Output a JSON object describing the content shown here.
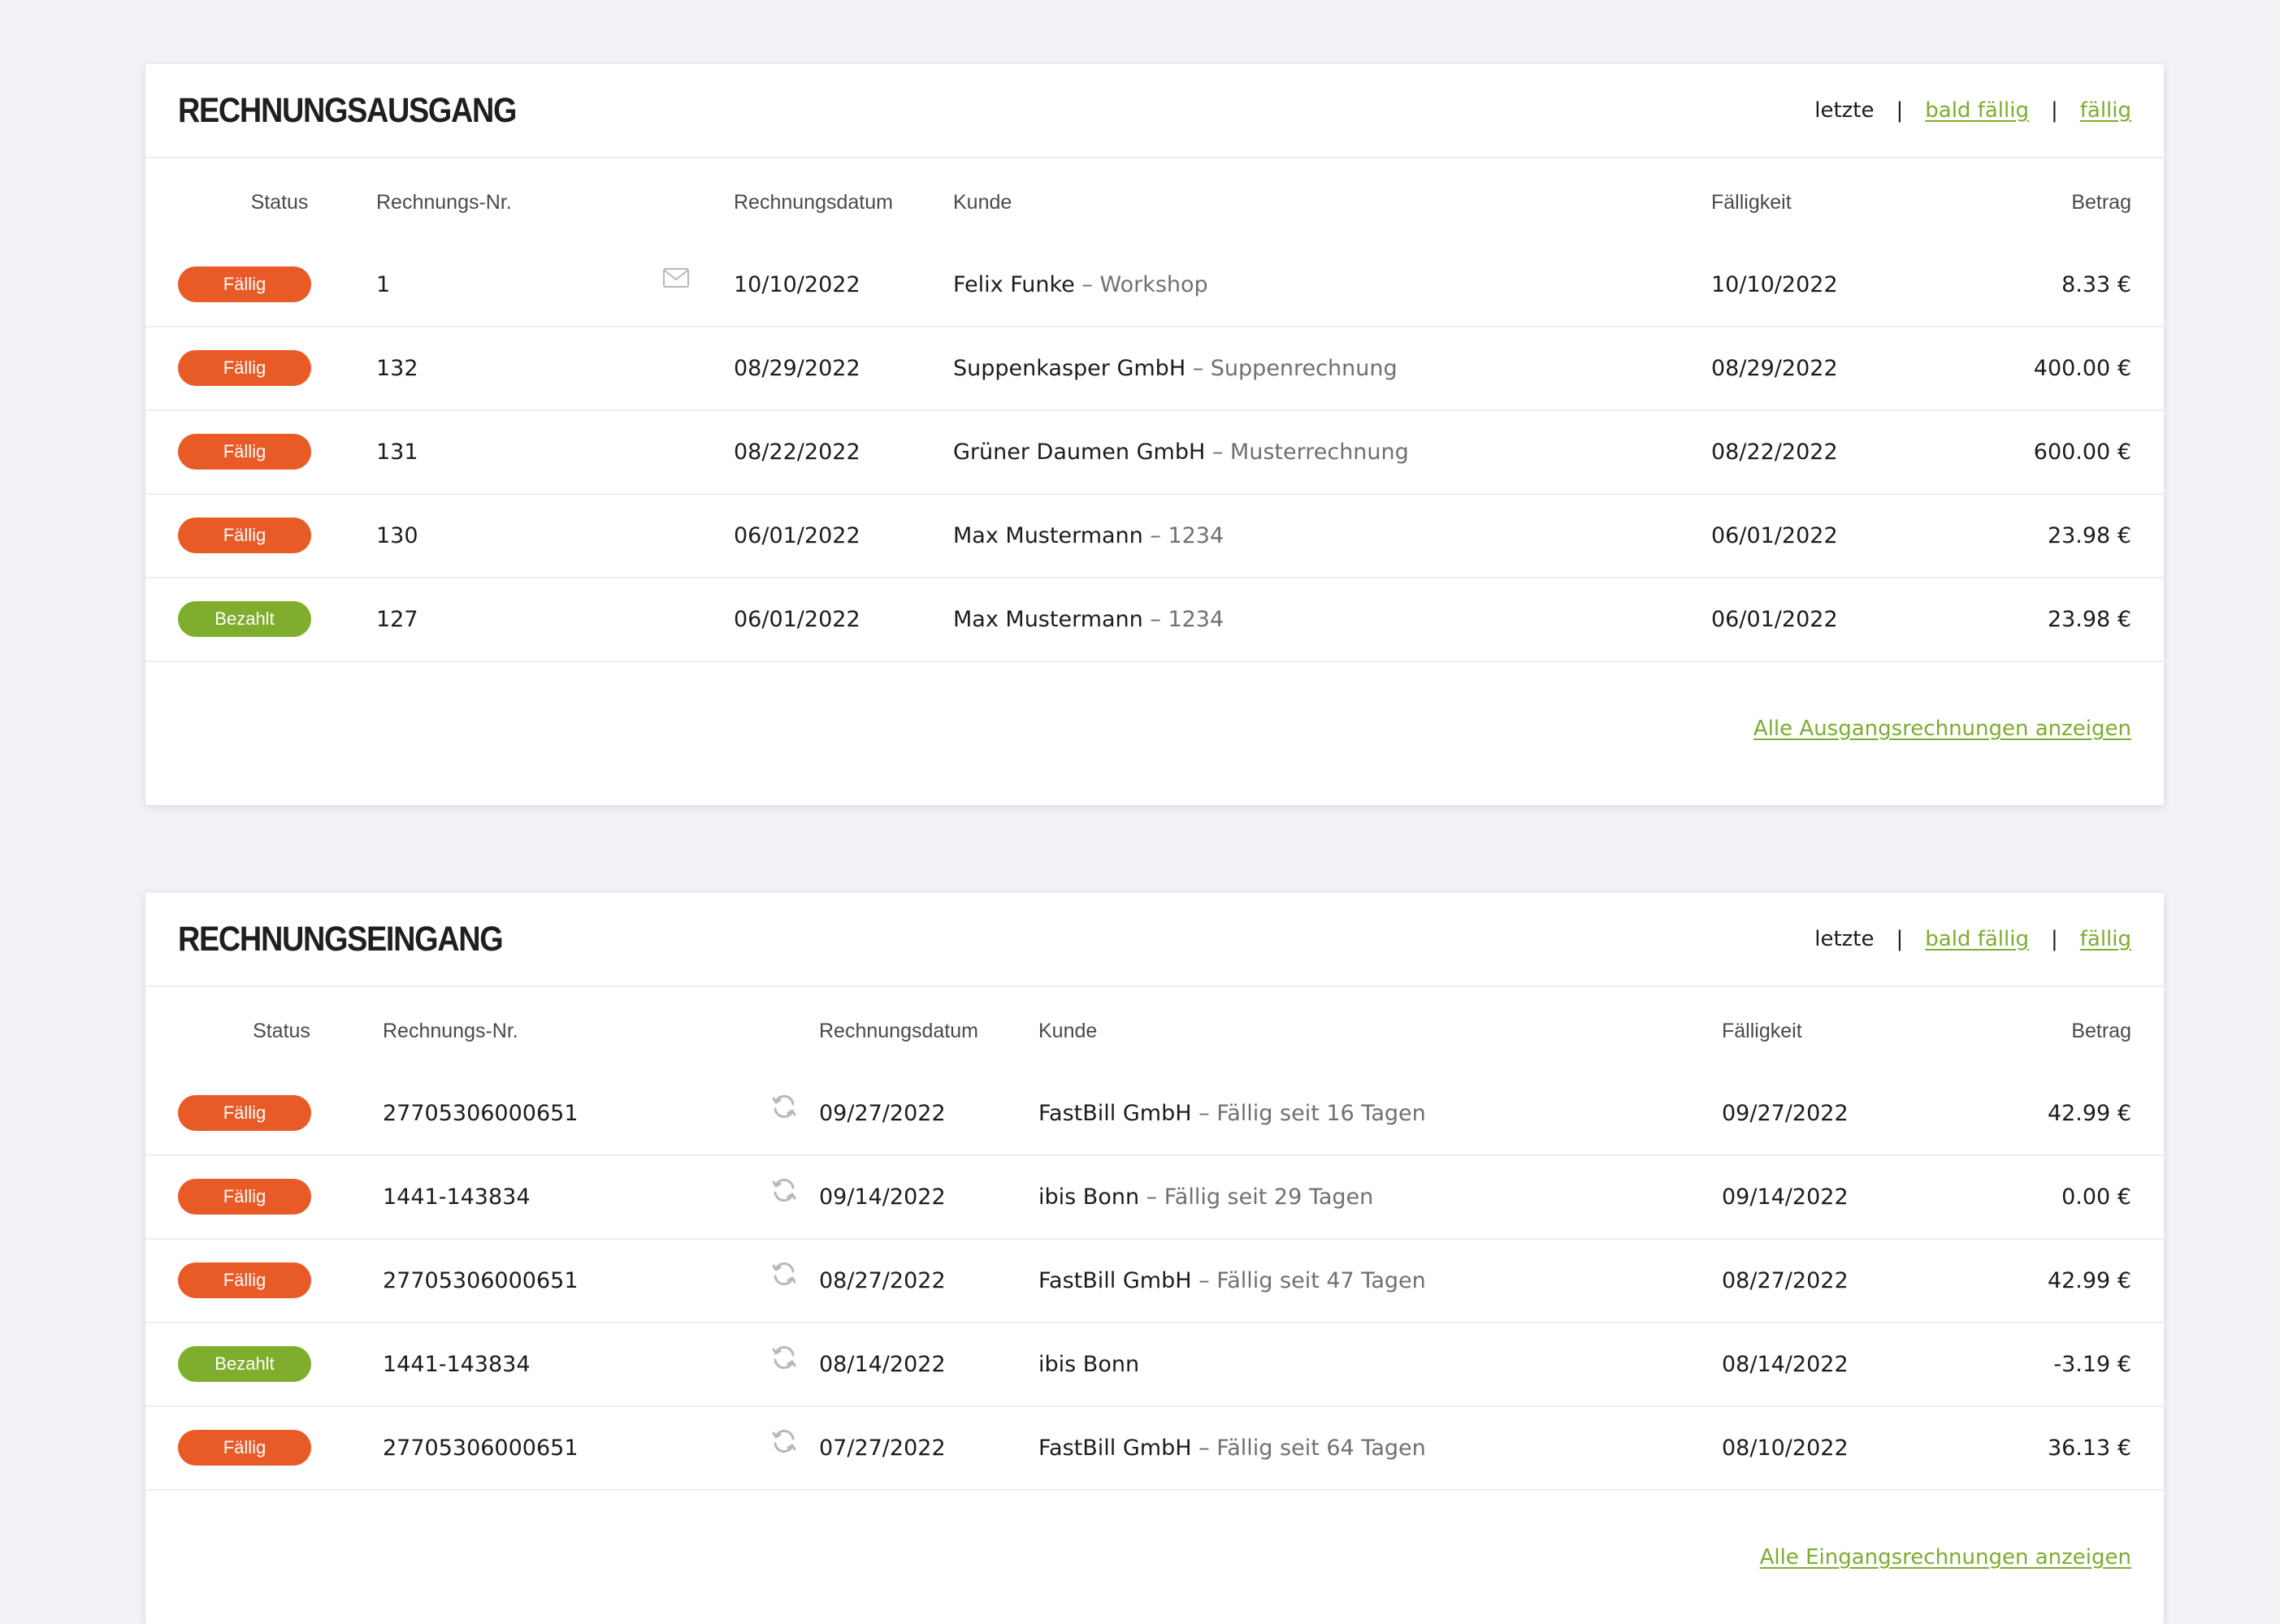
{
  "outgoing": {
    "title": "RECHNUNGSAUSGANG",
    "filters": {
      "active": "letzte",
      "sep": "|",
      "soon": "bald fällig ",
      "due": "fällig"
    },
    "columns": {
      "status": "Status",
      "number": "Rechnungs-Nr.",
      "date": "Rechnungsdatum",
      "customer": "Kunde",
      "due": "Fälligkeit",
      "amount": "Betrag"
    },
    "rows": [
      {
        "status": "Fällig",
        "status_kind": "due",
        "number": "1",
        "icon": "envelope-icon",
        "date": "10/10/2022",
        "customer": "Felix Funke",
        "subject": " – Workshop",
        "due": "10/10/2022",
        "amount": "8.33 €"
      },
      {
        "status": "Fällig",
        "status_kind": "due",
        "number": "132",
        "date": "08/29/2022",
        "customer": "Suppenkasper GmbH",
        "subject": " – Suppenrechnung",
        "due": "08/29/2022",
        "amount": "400.00 €"
      },
      {
        "status": "Fällig",
        "status_kind": "due",
        "number": "131",
        "date": "08/22/2022",
        "customer": "Grüner Daumen GmbH",
        "subject": " – Musterrechnung",
        "due": "08/22/2022",
        "amount": "600.00 €"
      },
      {
        "status": "Fällig",
        "status_kind": "due",
        "number": "130",
        "date": "06/01/2022",
        "customer": "Max Mustermann",
        "subject": " – 1234",
        "due": "06/01/2022",
        "amount": "23.98 €"
      },
      {
        "status": "Bezahlt",
        "status_kind": "paid",
        "number": "127",
        "date": "06/01/2022",
        "customer": "Max Mustermann",
        "subject": " – 1234",
        "due": "06/01/2022",
        "amount": "23.98 €"
      }
    ],
    "footer_link": "Alle Ausgangsrechnungen anzeigen"
  },
  "incoming": {
    "title": "RECHNUNGSEINGANG",
    "filters": {
      "active": "letzte",
      "sep": "|",
      "soon": "bald fällig ",
      "due": "fällig"
    },
    "columns": {
      "status": "Status",
      "number": "Rechnungs-Nr.",
      "date": "Rechnungsdatum",
      "customer": "Kunde",
      "due": "Fälligkeit",
      "amount": "Betrag"
    },
    "rows": [
      {
        "status": "Fällig",
        "status_kind": "due",
        "number": "27705306000651",
        "icon": "recurring-icon",
        "date": "09/27/2022",
        "customer": "FastBill GmbH",
        "subject": " – Fällig seit 16 Tagen",
        "due": "09/27/2022",
        "amount": "42.99 €"
      },
      {
        "status": "Fällig",
        "status_kind": "due",
        "number": "1441-143834",
        "icon": "recurring-icon",
        "date": "09/14/2022",
        "customer": "ibis Bonn",
        "subject": " – Fällig seit 29 Tagen",
        "due": "09/14/2022",
        "amount": "0.00 €"
      },
      {
        "status": "Fällig",
        "status_kind": "due",
        "number": "27705306000651",
        "icon": "recurring-icon",
        "date": "08/27/2022",
        "customer": "FastBill GmbH",
        "subject": " – Fällig seit 47 Tagen",
        "due": "08/27/2022",
        "amount": "42.99 €"
      },
      {
        "status": "Bezahlt",
        "status_kind": "paid",
        "number": "1441-143834",
        "icon": "recurring-icon",
        "date": "08/14/2022",
        "customer": "ibis Bonn",
        "subject": "",
        "due": "08/14/2022",
        "amount": "-3.19 €"
      },
      {
        "status": "Fällig",
        "status_kind": "due",
        "number": "27705306000651",
        "icon": "recurring-icon",
        "date": "07/27/2022",
        "customer": "FastBill GmbH",
        "subject": " – Fällig seit 64 Tagen",
        "due": "08/10/2022",
        "amount": "36.13 €"
      }
    ],
    "footer_link": "Alle Eingangsrechnungen anzeigen"
  },
  "colors": {
    "due": "#e85a26",
    "paid": "#7fae2e",
    "link": "#7cad2e",
    "background": "#f1f2f5"
  }
}
